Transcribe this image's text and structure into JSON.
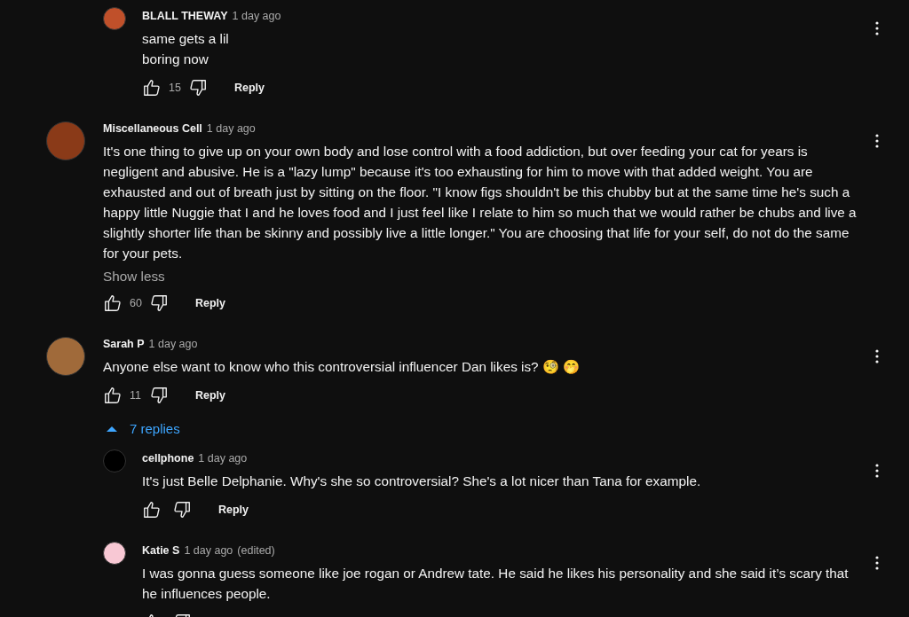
{
  "comments": [
    {
      "kind": "reply",
      "author": "BLALL THEWAY",
      "time": "1 day ago",
      "color": "#c0502a",
      "text": "same gets a lil\nboring now",
      "likes": "15",
      "reply_label": "Reply"
    },
    {
      "kind": "top",
      "author": "Miscellaneous Cell",
      "time": "1 day ago",
      "color": "#8a3a18",
      "text": "It's one thing to give up on your own body and lose control with a food addiction, but over feeding your cat for years is negligent and abusive. He is a \"lazy lump\" because it's too exhausting for him to move with that added weight. You are exhausted and out of breath just by sitting on the floor. \"I know figs shouldn't be this chubby but at the same time he's such a happy little Nuggie that I and he loves food and I just feel like I relate to him so much that we would rather be chubs and live a slightly shorter life than be skinny and possibly live a little longer.\" You are choosing that life for your self, do not do the same for your pets.",
      "show_less": "Show less",
      "likes": "60",
      "reply_label": "Reply"
    },
    {
      "kind": "top",
      "author": "Sarah P",
      "time": "1 day ago",
      "color": "#a06a3a",
      "text": "Anyone else want to know who this controversial influencer Dan likes is? 🧐 🤭",
      "likes": "11",
      "reply_label": "Reply",
      "replies_toggle": {
        "label": "7 replies",
        "expanded": true
      }
    },
    {
      "kind": "reply",
      "author": "cellphone",
      "time": "1 day ago",
      "color": "#000000",
      "text": "It's just Belle Delphanie. Why's she so controversial? She's a lot nicer than Tana for example.",
      "reply_label": "Reply"
    },
    {
      "kind": "reply",
      "author": "Katie S",
      "time": "1 day ago",
      "edited": "(edited)",
      "color": "#f8c8d4",
      "text": "I was gonna guess someone like joe rogan or Andrew tate. He said he likes his personality and she said it’s scary that he influences people."
    }
  ]
}
